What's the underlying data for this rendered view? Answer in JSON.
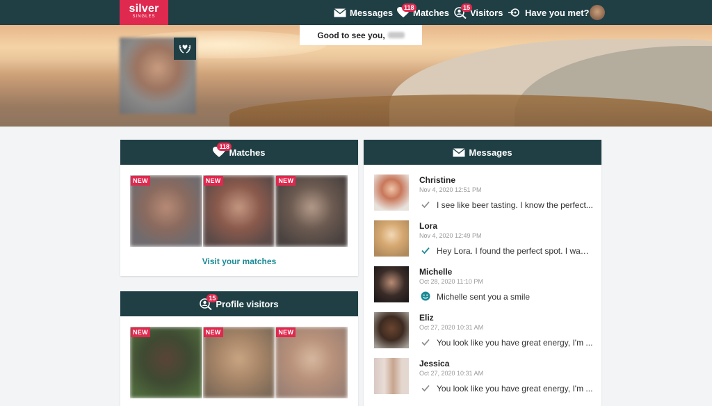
{
  "nav": {
    "logo_line1": "silver",
    "logo_line2": "SINGLES",
    "messages_label": "Messages",
    "matches_label": "Matches",
    "matches_badge": "118",
    "visitors_label": "Visitors",
    "visitors_badge": "15",
    "have_you_met_label": "Have you met?"
  },
  "hero": {
    "greeting": "Good to see you,"
  },
  "matches_card": {
    "title": "Matches",
    "badge": "118",
    "new_label": "NEW",
    "visit_link": "Visit your matches"
  },
  "visitors_card": {
    "title": "Profile visitors",
    "badge": "15",
    "new_label": "NEW"
  },
  "messages_card": {
    "title": "Messages",
    "items": [
      {
        "name": "Christine",
        "time": "Nov 4, 2020 12:51 PM",
        "text": "I see like beer tasting. I know the perfect...",
        "status": "check-grey-icon"
      },
      {
        "name": "Lora",
        "time": "Nov 4, 2020 12:49 PM",
        "text": "Hey Lora. I found the perfect spot. I want...",
        "status": "check-teal-icon"
      },
      {
        "name": "Michelle",
        "time": "Oct 28, 2020 11:10 PM",
        "text": "Michelle sent you a smile",
        "status": "smile-icon"
      },
      {
        "name": "Eliz",
        "time": "Oct 27, 2020 10:31 AM",
        "text": "You look like you have great energy, I'm ...",
        "status": "check-grey-icon"
      },
      {
        "name": "Jessica",
        "time": "Oct 27, 2020 10:31 AM",
        "text": "You look like you have great energy, I'm ...",
        "status": "check-grey-icon"
      }
    ]
  },
  "colors": {
    "nav_bg": "#1f3f45",
    "brand_red": "#e0294f",
    "link_teal": "#1a8a96"
  }
}
